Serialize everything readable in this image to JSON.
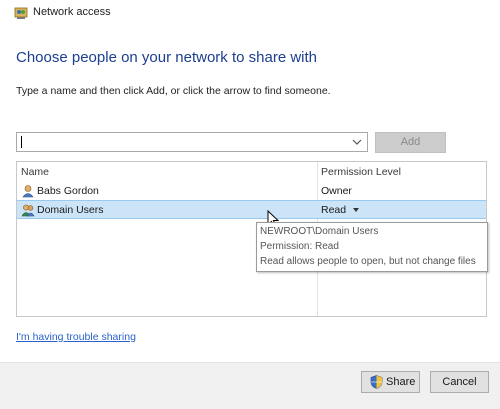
{
  "window": {
    "title": "Network access",
    "icon": "network-share-icon"
  },
  "heading": "Choose people on your network to share with",
  "instructions": "Type a name and then click Add, or click the arrow to find someone.",
  "name_input": {
    "value": "",
    "placeholder": "",
    "dropdown_icon": "chevron-down-icon"
  },
  "add_button_label": "Add",
  "list": {
    "columns": {
      "name": "Name",
      "permission": "Permission Level"
    },
    "rows": [
      {
        "name": "Babs Gordon",
        "permission": "Owner",
        "icon": "user-icon",
        "selected": false
      },
      {
        "name": "Domain Users",
        "permission": "Read",
        "icon": "user-group-icon",
        "selected": true
      }
    ]
  },
  "tooltip": {
    "line1": "NEWROOT\\Domain Users",
    "line2": "Permission: Read",
    "line3": "Read allows people to open, but not change files"
  },
  "trouble_link": "I'm having trouble sharing",
  "buttons": {
    "share": "Share",
    "cancel": "Cancel"
  },
  "colors": {
    "heading": "#1c3f8f",
    "selection": "#cce4f7",
    "link": "#2a62c9",
    "footer": "#f0f0f0"
  }
}
